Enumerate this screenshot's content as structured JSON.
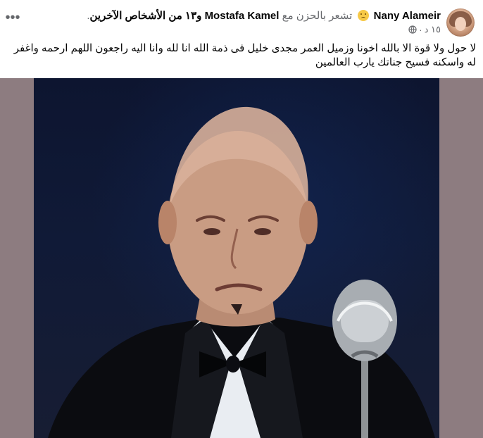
{
  "header": {
    "author": "Nany Alameir",
    "feeling_text": "تشعر بالحزن مع",
    "tagged_name": "Mostafa Kamel",
    "others_text": "و١٣ من الأشخاص الآخرين",
    "time": "١٥ د",
    "separator": "·",
    "more_label": "•••"
  },
  "post": {
    "text": "لا حول ولا قوة الا بالله اخونا وزميل العمر مجدى خليل فى ذمة الله انا لله وانا اليه راجعون اللهم ارحمه واغفر له واسكنه فسيح جناتك يارب العالمين"
  },
  "icons": {
    "avatar": "profile-photo",
    "feeling": "sad-face-emoji",
    "privacy": "globe-icon",
    "menu": "more-options-icon"
  },
  "colors": {
    "muted": "#65676b",
    "background": "#ffffff",
    "photo_bg": "#8d7c80"
  }
}
